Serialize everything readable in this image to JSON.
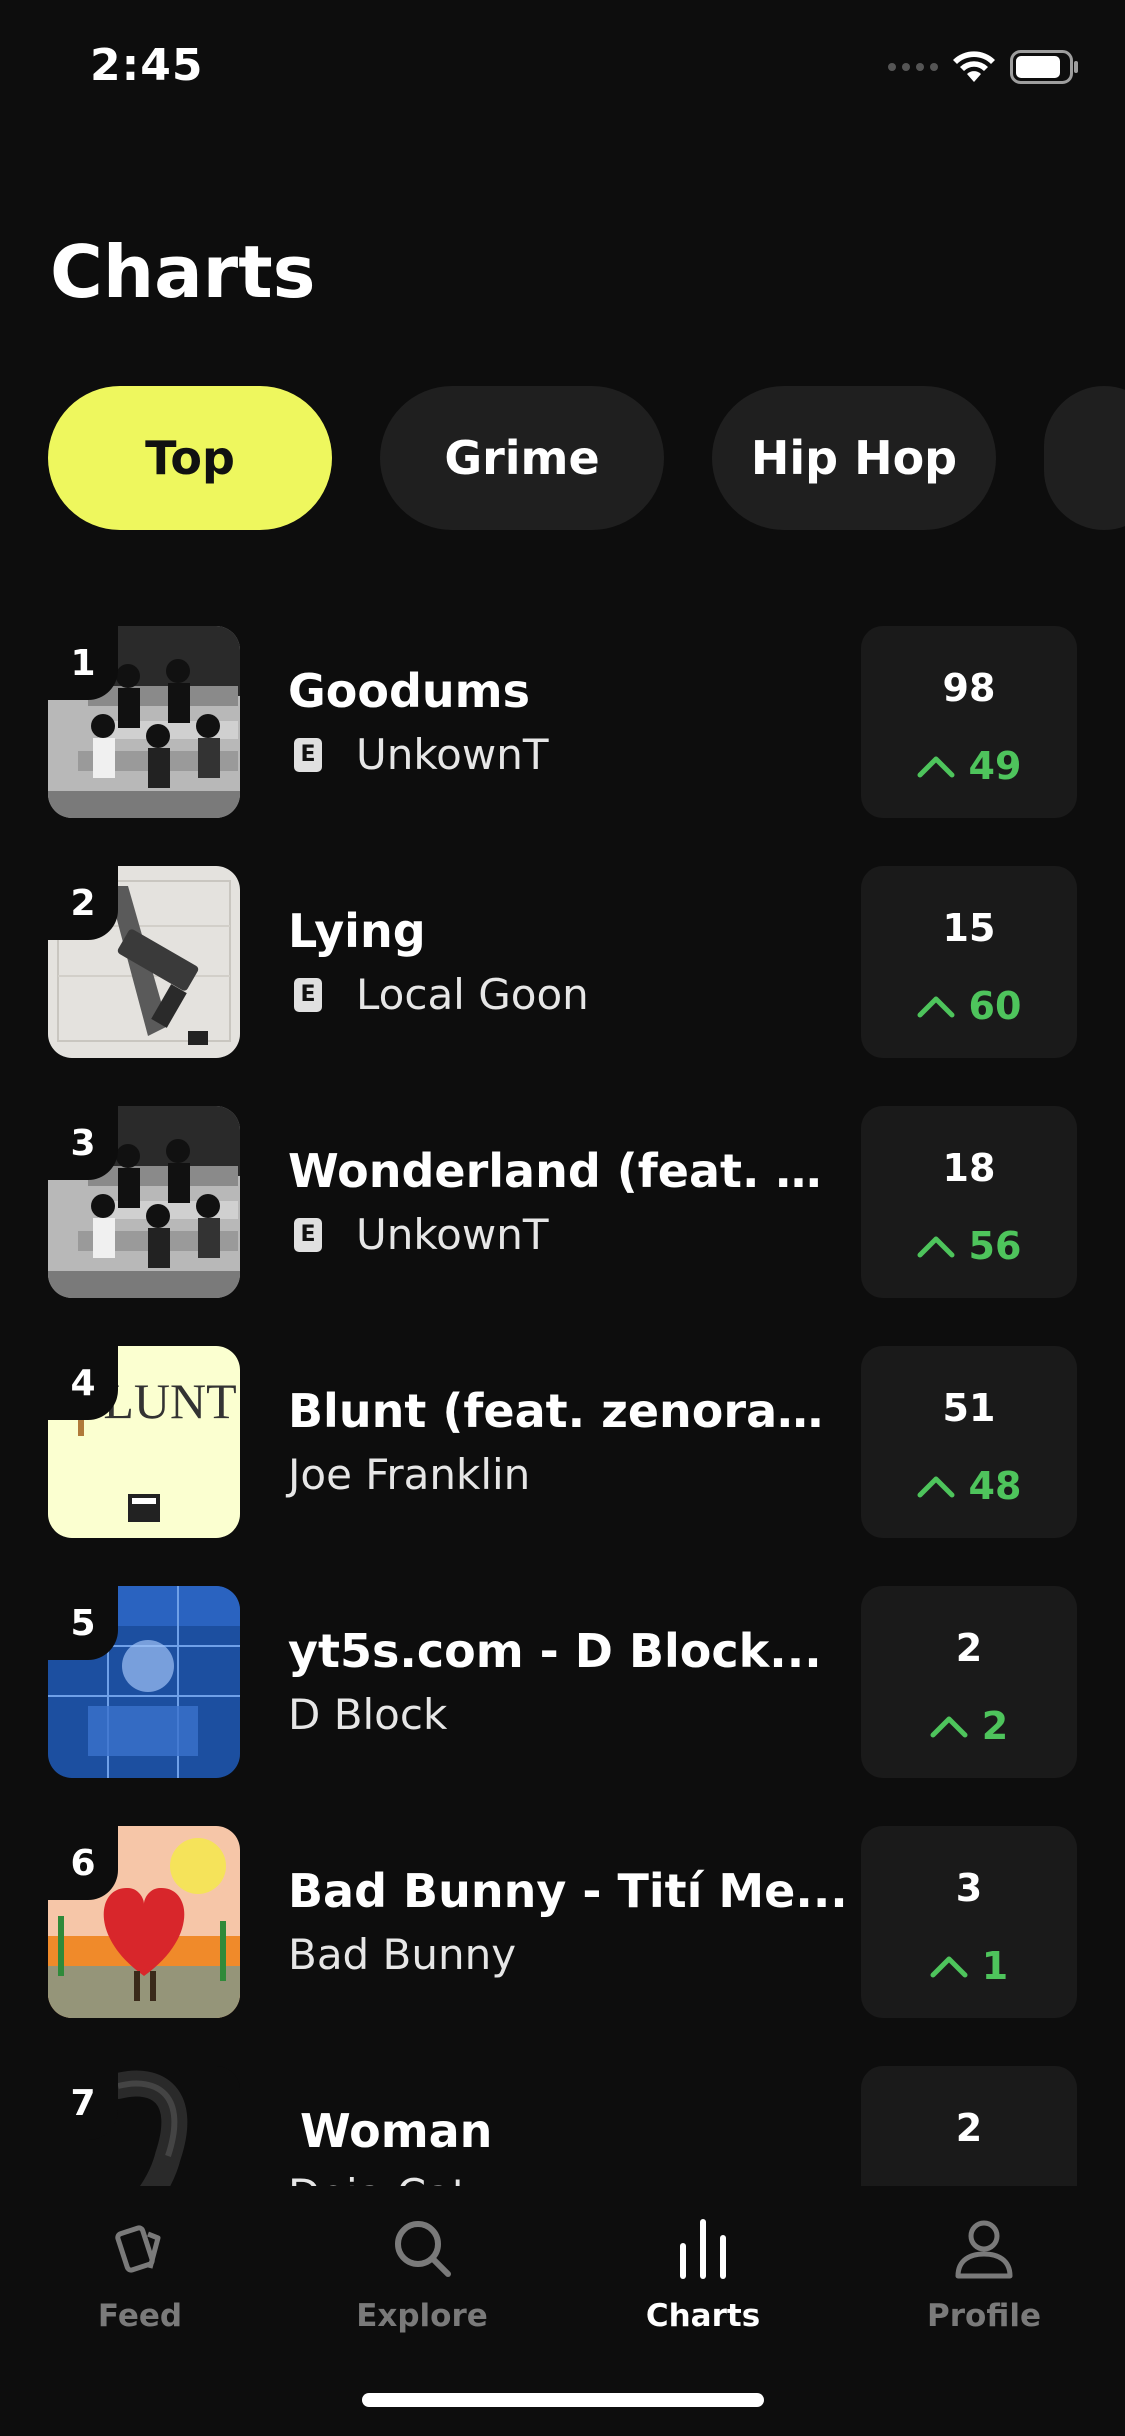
{
  "status_bar": {
    "time": "2:45"
  },
  "header": {
    "title": "Charts"
  },
  "filters": [
    {
      "label": "Top",
      "active": true
    },
    {
      "label": "Grime",
      "active": false
    },
    {
      "label": "Hip Hop",
      "active": false
    }
  ],
  "chart": [
    {
      "rank": "1",
      "title": "Goodums",
      "artist": "UnkownT",
      "explicit": true,
      "badge": "E",
      "value": "98",
      "change": "49",
      "direction": "up"
    },
    {
      "rank": "2",
      "title": "Lying",
      "artist": "Local Goon",
      "explicit": true,
      "badge": "E",
      "value": "15",
      "change": "60",
      "direction": "up"
    },
    {
      "rank": "3",
      "title": "Wonderland (feat. M...",
      "artist": "UnkownT",
      "explicit": true,
      "badge": "E",
      "value": "18",
      "change": "56",
      "direction": "up"
    },
    {
      "rank": "4",
      "title": "Blunt (feat. zenorac...",
      "artist": "Joe Franklin",
      "explicit": false,
      "value": "51",
      "change": "48",
      "direction": "up",
      "cover_text": "BLUNT"
    },
    {
      "rank": "5",
      "title": "yt5s.com - D Block...",
      "artist": "D Block",
      "explicit": false,
      "value": "2",
      "change": "2",
      "direction": "up"
    },
    {
      "rank": "6",
      "title": "Bad Bunny - Tití Me...",
      "artist": "Bad Bunny",
      "explicit": false,
      "value": "3",
      "change": "1",
      "direction": "up"
    },
    {
      "rank": "7",
      "title": "Woman",
      "artist": "Doja Cat",
      "explicit": false,
      "value": "2",
      "change": "",
      "direction": ""
    }
  ],
  "tab_bar": {
    "items": [
      {
        "label": "Feed",
        "icon": "feed-cards-icon",
        "active": false
      },
      {
        "label": "Explore",
        "icon": "search-icon",
        "active": false
      },
      {
        "label": "Charts",
        "icon": "bar-chart-icon",
        "active": true
      },
      {
        "label": "Profile",
        "icon": "person-icon",
        "active": false
      }
    ]
  },
  "colors": {
    "background": "#0d0d0d",
    "accent": "#eef75e",
    "positive": "#4ec45c",
    "surface": "#1a1a1a"
  }
}
